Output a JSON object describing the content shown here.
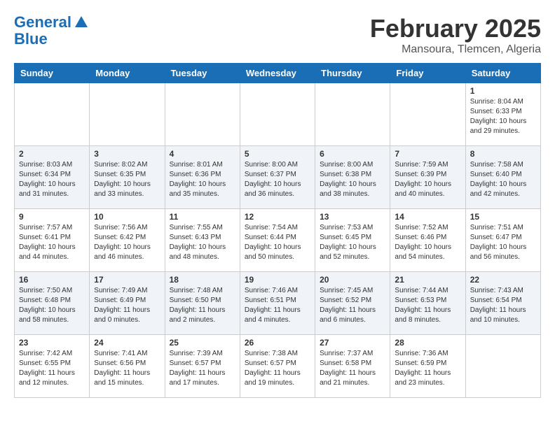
{
  "header": {
    "logo_line1": "General",
    "logo_line2": "Blue",
    "month": "February 2025",
    "location": "Mansoura, Tlemcen, Algeria"
  },
  "weekdays": [
    "Sunday",
    "Monday",
    "Tuesday",
    "Wednesday",
    "Thursday",
    "Friday",
    "Saturday"
  ],
  "weeks": [
    [
      {
        "day": "",
        "info": ""
      },
      {
        "day": "",
        "info": ""
      },
      {
        "day": "",
        "info": ""
      },
      {
        "day": "",
        "info": ""
      },
      {
        "day": "",
        "info": ""
      },
      {
        "day": "",
        "info": ""
      },
      {
        "day": "1",
        "info": "Sunrise: 8:04 AM\nSunset: 6:33 PM\nDaylight: 10 hours and 29 minutes."
      }
    ],
    [
      {
        "day": "2",
        "info": "Sunrise: 8:03 AM\nSunset: 6:34 PM\nDaylight: 10 hours and 31 minutes."
      },
      {
        "day": "3",
        "info": "Sunrise: 8:02 AM\nSunset: 6:35 PM\nDaylight: 10 hours and 33 minutes."
      },
      {
        "day": "4",
        "info": "Sunrise: 8:01 AM\nSunset: 6:36 PM\nDaylight: 10 hours and 35 minutes."
      },
      {
        "day": "5",
        "info": "Sunrise: 8:00 AM\nSunset: 6:37 PM\nDaylight: 10 hours and 36 minutes."
      },
      {
        "day": "6",
        "info": "Sunrise: 8:00 AM\nSunset: 6:38 PM\nDaylight: 10 hours and 38 minutes."
      },
      {
        "day": "7",
        "info": "Sunrise: 7:59 AM\nSunset: 6:39 PM\nDaylight: 10 hours and 40 minutes."
      },
      {
        "day": "8",
        "info": "Sunrise: 7:58 AM\nSunset: 6:40 PM\nDaylight: 10 hours and 42 minutes."
      }
    ],
    [
      {
        "day": "9",
        "info": "Sunrise: 7:57 AM\nSunset: 6:41 PM\nDaylight: 10 hours and 44 minutes."
      },
      {
        "day": "10",
        "info": "Sunrise: 7:56 AM\nSunset: 6:42 PM\nDaylight: 10 hours and 46 minutes."
      },
      {
        "day": "11",
        "info": "Sunrise: 7:55 AM\nSunset: 6:43 PM\nDaylight: 10 hours and 48 minutes."
      },
      {
        "day": "12",
        "info": "Sunrise: 7:54 AM\nSunset: 6:44 PM\nDaylight: 10 hours and 50 minutes."
      },
      {
        "day": "13",
        "info": "Sunrise: 7:53 AM\nSunset: 6:45 PM\nDaylight: 10 hours and 52 minutes."
      },
      {
        "day": "14",
        "info": "Sunrise: 7:52 AM\nSunset: 6:46 PM\nDaylight: 10 hours and 54 minutes."
      },
      {
        "day": "15",
        "info": "Sunrise: 7:51 AM\nSunset: 6:47 PM\nDaylight: 10 hours and 56 minutes."
      }
    ],
    [
      {
        "day": "16",
        "info": "Sunrise: 7:50 AM\nSunset: 6:48 PM\nDaylight: 10 hours and 58 minutes."
      },
      {
        "day": "17",
        "info": "Sunrise: 7:49 AM\nSunset: 6:49 PM\nDaylight: 11 hours and 0 minutes."
      },
      {
        "day": "18",
        "info": "Sunrise: 7:48 AM\nSunset: 6:50 PM\nDaylight: 11 hours and 2 minutes."
      },
      {
        "day": "19",
        "info": "Sunrise: 7:46 AM\nSunset: 6:51 PM\nDaylight: 11 hours and 4 minutes."
      },
      {
        "day": "20",
        "info": "Sunrise: 7:45 AM\nSunset: 6:52 PM\nDaylight: 11 hours and 6 minutes."
      },
      {
        "day": "21",
        "info": "Sunrise: 7:44 AM\nSunset: 6:53 PM\nDaylight: 11 hours and 8 minutes."
      },
      {
        "day": "22",
        "info": "Sunrise: 7:43 AM\nSunset: 6:54 PM\nDaylight: 11 hours and 10 minutes."
      }
    ],
    [
      {
        "day": "23",
        "info": "Sunrise: 7:42 AM\nSunset: 6:55 PM\nDaylight: 11 hours and 12 minutes."
      },
      {
        "day": "24",
        "info": "Sunrise: 7:41 AM\nSunset: 6:56 PM\nDaylight: 11 hours and 15 minutes."
      },
      {
        "day": "25",
        "info": "Sunrise: 7:39 AM\nSunset: 6:57 PM\nDaylight: 11 hours and 17 minutes."
      },
      {
        "day": "26",
        "info": "Sunrise: 7:38 AM\nSunset: 6:57 PM\nDaylight: 11 hours and 19 minutes."
      },
      {
        "day": "27",
        "info": "Sunrise: 7:37 AM\nSunset: 6:58 PM\nDaylight: 11 hours and 21 minutes."
      },
      {
        "day": "28",
        "info": "Sunrise: 7:36 AM\nSunset: 6:59 PM\nDaylight: 11 hours and 23 minutes."
      },
      {
        "day": "",
        "info": ""
      }
    ]
  ]
}
